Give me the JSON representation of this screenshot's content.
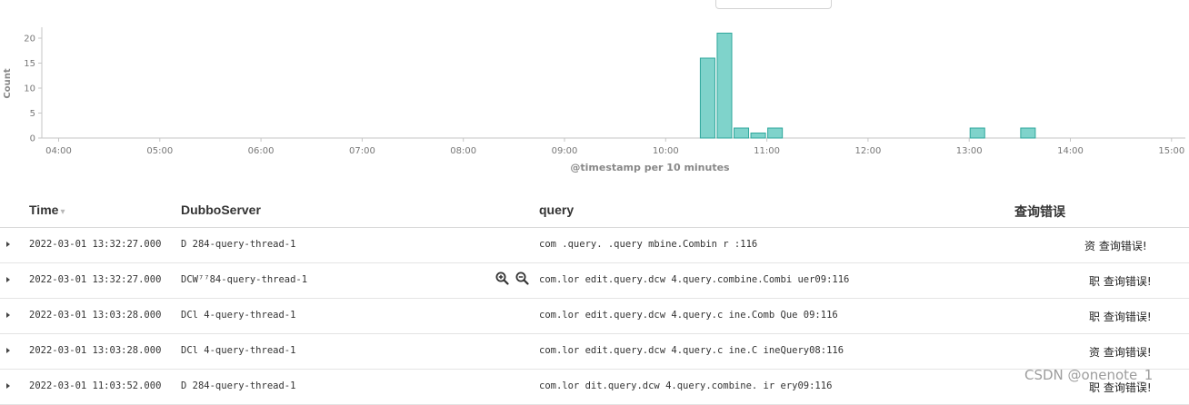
{
  "chart_data": {
    "type": "bar",
    "ylabel": "Count",
    "xlabel": "@timestamp per 10 minutes",
    "x_ticks": [
      "04:00",
      "05:00",
      "06:00",
      "07:00",
      "08:00",
      "09:00",
      "10:00",
      "11:00",
      "12:00",
      "13:00",
      "14:00",
      "15:00"
    ],
    "y_ticks": [
      0,
      5,
      10,
      15,
      20
    ],
    "ylim": [
      0,
      22
    ],
    "bar_interval_minutes": 10,
    "bars": [
      {
        "x": "10:20",
        "value": 16
      },
      {
        "x": "10:30",
        "value": 21
      },
      {
        "x": "10:40",
        "value": 2
      },
      {
        "x": "10:50",
        "value": 1
      },
      {
        "x": "11:00",
        "value": 2
      },
      {
        "x": "13:00",
        "value": 2
      },
      {
        "x": "13:30",
        "value": 2
      }
    ],
    "colors": {
      "bar_fill": "#7fd3cb",
      "bar_stroke": "#2fa79c",
      "axis": "#c6c6c6",
      "tick_text": "#777777"
    }
  },
  "table": {
    "columns": [
      {
        "label": "Time",
        "sortable": true
      },
      {
        "label": "DubboServer"
      },
      {
        "label": "query"
      },
      {
        "label": "查询错误"
      }
    ],
    "rows": [
      {
        "time": "2022-03-01 13:32:27.000",
        "dubbo": "D    284-query-thread-1",
        "query": "com         .query.      .query  mbine.Combin  r   :116",
        "error": "资 查询错误!"
      },
      {
        "time": "2022-03-01 13:32:27.000",
        "dubbo": "DCW⁷⁷84-query-thread-1",
        "query": "com.lor     edit.query.dcw    4.query.combine.Combi    uer09:116",
        "error": "职 查询错误!"
      },
      {
        "time": "2022-03-01 13:03:28.000",
        "dubbo": "DCl   4-query-thread-1",
        "query": "com.lor     edit.query.dcw    4.query.c    ine.Comb    Que  09:116",
        "error": "职 查询错误!"
      },
      {
        "time": "2022-03-01 13:03:28.000",
        "dubbo": "DCl    4-query-thread-1",
        "query": "com.lor     edit.query.dcw    4.query.c    ine.C     ineQuery08:116",
        "error": "资 查询错误!"
      },
      {
        "time": "2022-03-01 11:03:52.000",
        "dubbo": "D    284-query-thread-1",
        "query": "com.lor     dit.query.dcw    4.query.combine.    ir    ery09:116",
        "error": "职 查询错误!"
      }
    ]
  },
  "watermark": "CSDN @onenote_1"
}
